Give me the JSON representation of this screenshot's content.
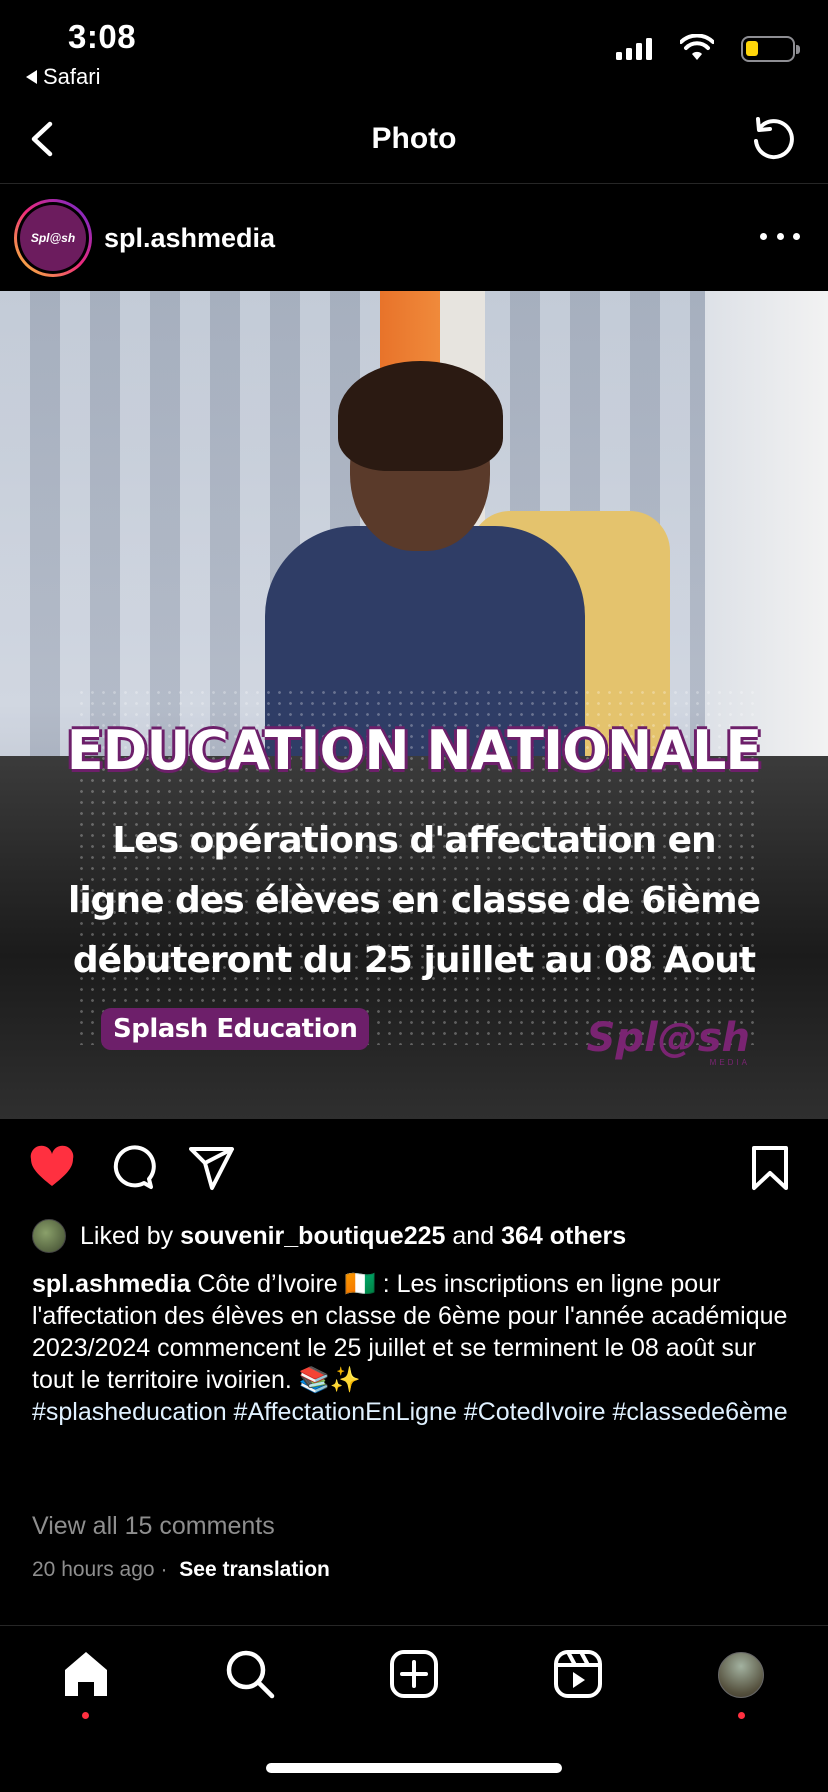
{
  "status": {
    "time": "3:08",
    "back_app": "Safari"
  },
  "nav": {
    "title": "Photo"
  },
  "post": {
    "username": "spl.ashmedia",
    "avatar_text": "Spl@sh",
    "image": {
      "headline": "EDUCATION NATIONALE",
      "line1": "Les opérations d'affectation en",
      "line2": "ligne des élèves en classe de 6ième",
      "line3": "débuteront du 25 juillet au 08 Aout",
      "badge": "Splash Education",
      "brand": "Spl@sh",
      "brand_sub": "MEDIA"
    },
    "likes": {
      "prefix": "Liked by",
      "user": "souvenir_boutique225",
      "and": "and",
      "others": "364 others"
    },
    "caption": {
      "user": "spl.ashmedia",
      "text": "Côte d’Ivoire 🇨🇮 : Les inscriptions en ligne pour l'affectation des élèves en classe de 6ème pour l'année académique 2023/2024 commencent le 25 juillet et se terminent le 08 août sur tout le territoire ivoirien. 📚✨",
      "hashtags": "#splasheducation #AffectationEnLigne #CotedIvoire #classede6ème"
    },
    "comments_link": "View all 15 comments",
    "time_ago": "20 hours ago",
    "separator": "·",
    "translate": "See translation"
  },
  "icons": {
    "status": [
      "signal-icon",
      "wifi-icon",
      "battery-icon"
    ],
    "nav": [
      "back-chevron-icon",
      "refresh-icon"
    ],
    "actions": [
      "heart-filled-icon",
      "comment-icon",
      "share-icon",
      "bookmark-icon"
    ],
    "tabs": [
      "home-icon",
      "search-icon",
      "create-icon",
      "reels-icon",
      "profile-icon"
    ]
  },
  "colors": {
    "like": "#ff3040",
    "brand_purple": "#6d1f6a",
    "secondary_text": "#8e8e8e"
  }
}
